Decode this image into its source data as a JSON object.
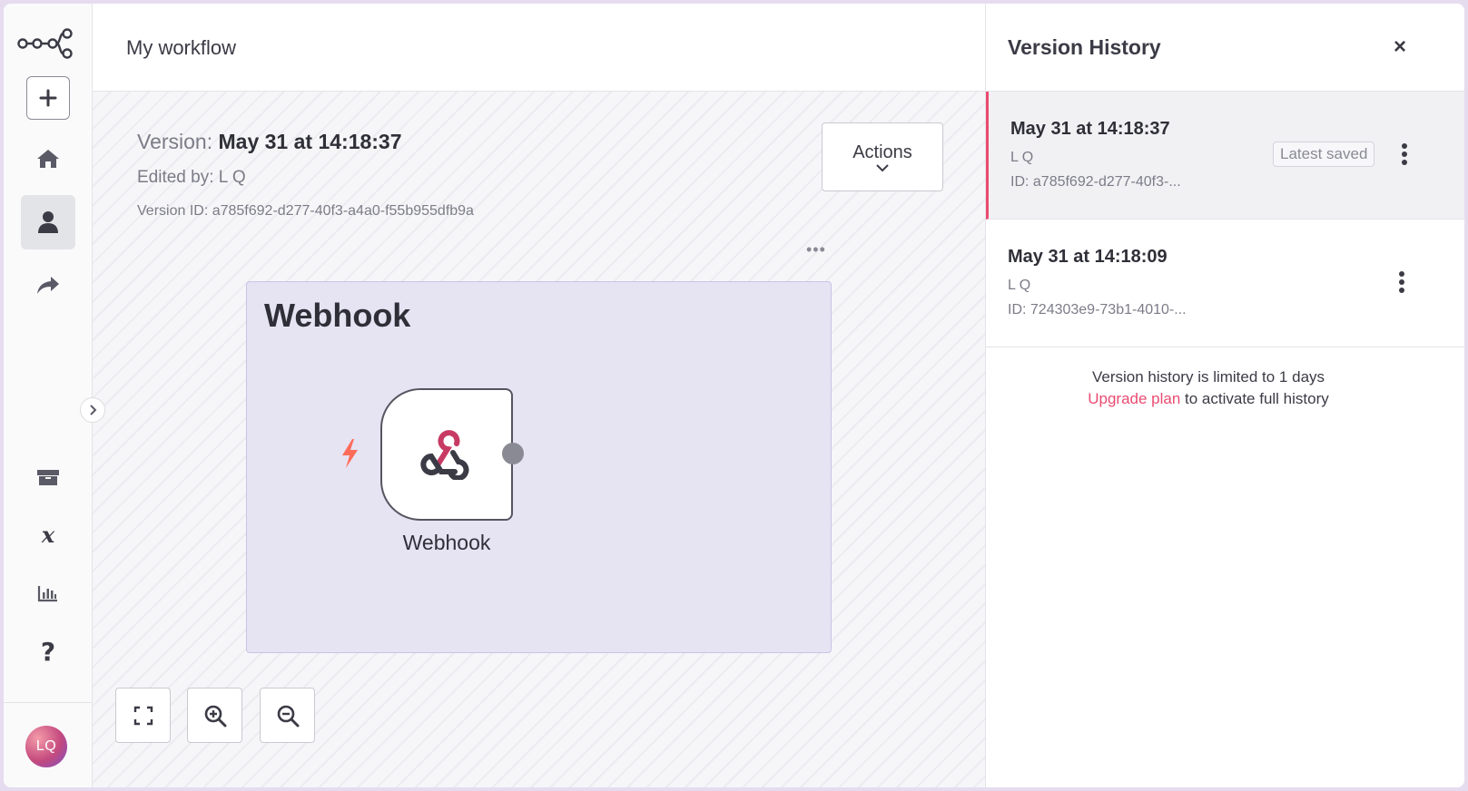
{
  "app": {
    "workflow_name": "My workflow"
  },
  "sidebar": {
    "items": [
      {
        "name": "add",
        "icon": "plus-icon"
      },
      {
        "name": "overview",
        "icon": "home-icon"
      },
      {
        "name": "personal",
        "icon": "user-icon",
        "active": true
      },
      {
        "name": "shared",
        "icon": "share-arrow-icon"
      },
      {
        "name": "templates",
        "icon": "box-icon"
      },
      {
        "name": "variables",
        "icon": "variable-x-icon"
      },
      {
        "name": "insights",
        "icon": "bar-chart-icon"
      },
      {
        "name": "help",
        "icon": "question-icon"
      }
    ],
    "avatar_initials": "LQ"
  },
  "canvas": {
    "version_label": "Version:",
    "version_value": "May 31 at 14:18:37",
    "edited_by": "Edited by: L Q",
    "version_id": "Version ID: a785f692-d277-40f3-a4a0-f55b955dfb9a",
    "actions_label": "Actions",
    "sticky_menu": "•••",
    "sticky_title": "Webhook",
    "node_label": "Webhook"
  },
  "version_history": {
    "title": "Version History",
    "close": "×",
    "versions": [
      {
        "date": "May 31 at 14:18:37",
        "author": "L Q",
        "id": "ID: a785f692-d277-40f3-...",
        "badge": "Latest saved"
      },
      {
        "date": "May 31 at 14:18:09",
        "author": "L Q",
        "id": "ID: 724303e9-73b1-4010-..."
      }
    ],
    "limit_text": "Version history is limited to 1 days",
    "upgrade_link": "Upgrade plan",
    "upgrade_suffix": " to activate full history"
  },
  "colors": {
    "accent": "#ea4b71",
    "sticky_bg": "#e6e3f3",
    "trigger": "#ff6d5a"
  }
}
